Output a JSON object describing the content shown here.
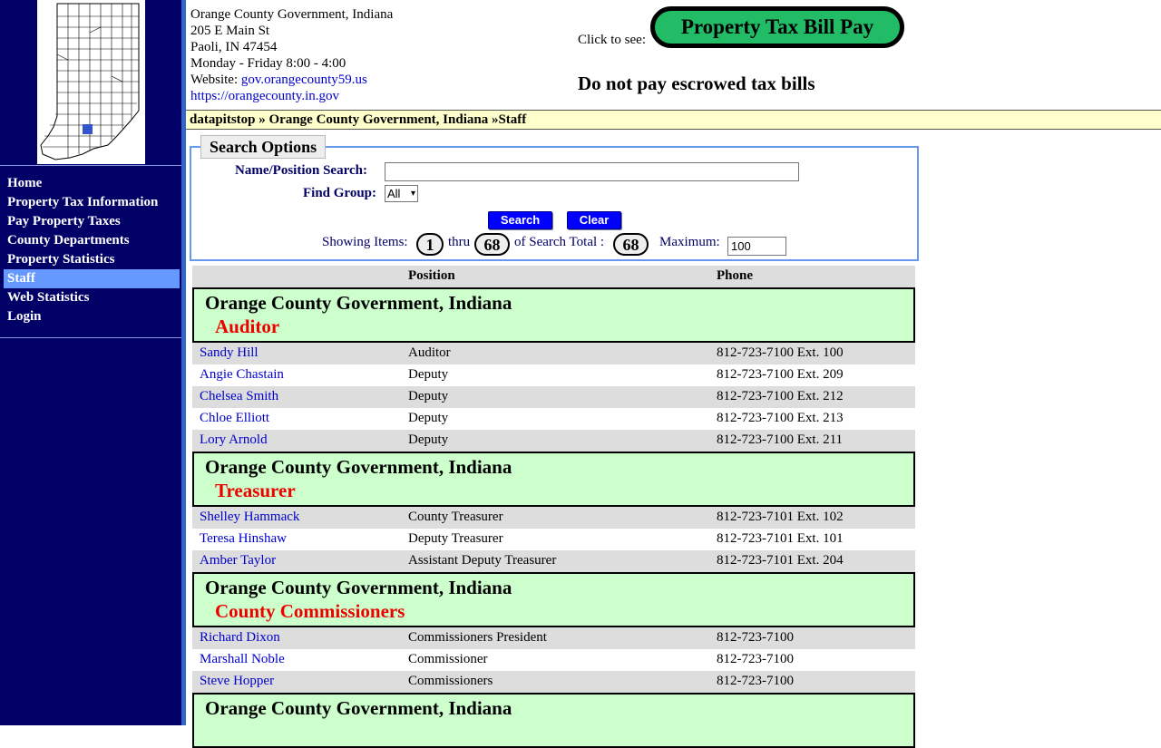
{
  "sidebar": {
    "map_alt": "Indiana county map",
    "items": [
      {
        "label": "Home",
        "active": false
      },
      {
        "label": "Property Tax Information",
        "active": false
      },
      {
        "label": "Pay Property Taxes",
        "active": false
      },
      {
        "label": "County Departments",
        "active": false
      },
      {
        "label": "Property Statistics",
        "active": false
      },
      {
        "label": "Staff",
        "active": true
      },
      {
        "label": "Web Statistics",
        "active": false
      },
      {
        "label": "Login",
        "active": false
      }
    ]
  },
  "header": {
    "org": "Orange County Government, Indiana",
    "street": "205 E Main St",
    "city": "Paoli, IN 47454",
    "hours": "Monday - Friday 8:00 - 4:00",
    "website_label": "Website: ",
    "website_link": "gov.orangecounty59.us",
    "alt_link": "https://orangecounty.in.gov",
    "click_to_see": "Click to see:",
    "pay_button": "Property Tax Bill Pay",
    "escrow_notice": "Do not pay escrowed tax bills"
  },
  "breadcrumb": "datapitstop » Orange County Government, Indiana »Staff",
  "search": {
    "legend": "Search Options",
    "name_label": "Name/Position Search:",
    "name_value": "",
    "group_label": "Find Group:",
    "group_value": "All",
    "search_button": "Search",
    "clear_button": "Clear",
    "showing_label": "Showing Items:",
    "from": "1",
    "thru_label": "thru",
    "to": "68",
    "total_label": "of Search Total :",
    "total": "68",
    "maximum_label": "Maximum:",
    "maximum_value": "100"
  },
  "table": {
    "headers": {
      "name": "",
      "position": "Position",
      "phone": "Phone"
    },
    "groups": [
      {
        "org": "Orange County Government, Indiana",
        "department": "Auditor",
        "rows": [
          {
            "name": "Sandy Hill",
            "position": "Auditor",
            "phone": "812-723-7100 Ext. 100"
          },
          {
            "name": "Angie Chastain",
            "position": "Deputy",
            "phone": "812-723-7100 Ext. 209"
          },
          {
            "name": "Chelsea Smith",
            "position": "Deputy",
            "phone": "812-723-7100 Ext. 212"
          },
          {
            "name": "Chloe Elliott",
            "position": "Deputy",
            "phone": "812-723-7100 Ext. 213"
          },
          {
            "name": "Lory Arnold",
            "position": "Deputy",
            "phone": "812-723-7100 Ext. 211"
          }
        ]
      },
      {
        "org": "Orange County Government, Indiana",
        "department": "Treasurer",
        "rows": [
          {
            "name": "Shelley Hammack",
            "position": "County Treasurer",
            "phone": "812-723-7101 Ext. 102"
          },
          {
            "name": "Teresa Hinshaw",
            "position": "Deputy Treasurer",
            "phone": "812-723-7101 Ext. 101"
          },
          {
            "name": "Amber Taylor",
            "position": "Assistant Deputy Treasurer",
            "phone": "812-723-7101 Ext. 204"
          }
        ]
      },
      {
        "org": "Orange County Government, Indiana",
        "department": "County Commissioners",
        "rows": [
          {
            "name": "Richard Dixon",
            "position": "Commissioners President",
            "phone": "812-723-7100"
          },
          {
            "name": "Marshall Noble",
            "position": "Commissioner",
            "phone": "812-723-7100"
          },
          {
            "name": "Steve Hopper",
            "position": "Commissioners",
            "phone": "812-723-7100"
          }
        ]
      },
      {
        "org": "Orange County Government, Indiana",
        "department": "",
        "rows": []
      }
    ]
  },
  "colors": {
    "sidebar_bg": "#000066",
    "active_nav": "#6699ff",
    "pay_button": "#22bb66",
    "group_bg": "#ccffcc",
    "department_text": "#ee0000"
  }
}
